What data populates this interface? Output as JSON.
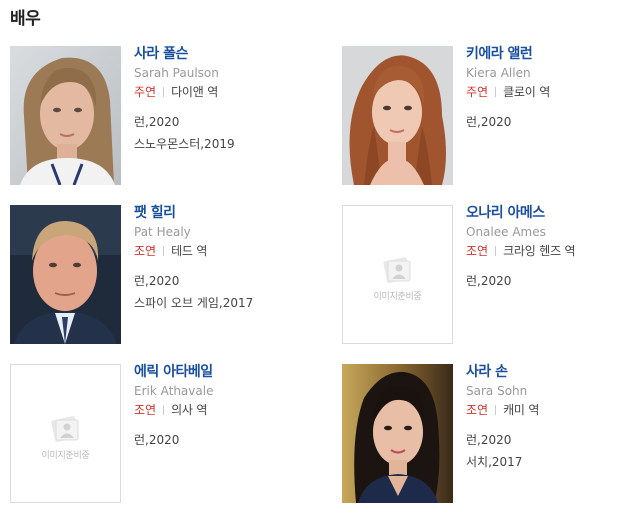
{
  "section": {
    "title": "배우"
  },
  "placeholder_text": "이미지준비중",
  "actors": [
    {
      "name": "사라 폴슨",
      "english_name": "Sarah Paulson",
      "role_type": "주연",
      "role": "다이앤 역",
      "works": [
        "런,2020",
        "스노우몬스터,2019"
      ],
      "has_photo": true
    },
    {
      "name": "키에라 앨런",
      "english_name": "Kiera Allen",
      "role_type": "주연",
      "role": "클로이 역",
      "works": [
        "런,2020"
      ],
      "has_photo": true
    },
    {
      "name": "팻 힐리",
      "english_name": "Pat Healy",
      "role_type": "조연",
      "role": "테드 역",
      "works": [
        "런,2020",
        "스파이 오브 게임,2017"
      ],
      "has_photo": true
    },
    {
      "name": "오나리 아메스",
      "english_name": "Onalee Ames",
      "role_type": "조연",
      "role": "크라잉 헨즈 역",
      "works": [
        "런,2020"
      ],
      "has_photo": false
    },
    {
      "name": "에릭 아타베일",
      "english_name": "Erik Athavale",
      "role_type": "조연",
      "role": "의사 역",
      "works": [
        "런,2020"
      ],
      "has_photo": false
    },
    {
      "name": "사라 손",
      "english_name": "Sara Sohn",
      "role_type": "조연",
      "role": "캐미 역",
      "works": [
        "런,2020",
        "서치,2017"
      ],
      "has_photo": true
    }
  ],
  "colors": {
    "name": "#1a4fa0",
    "role_type": "#d0332b",
    "english": "#999999"
  }
}
